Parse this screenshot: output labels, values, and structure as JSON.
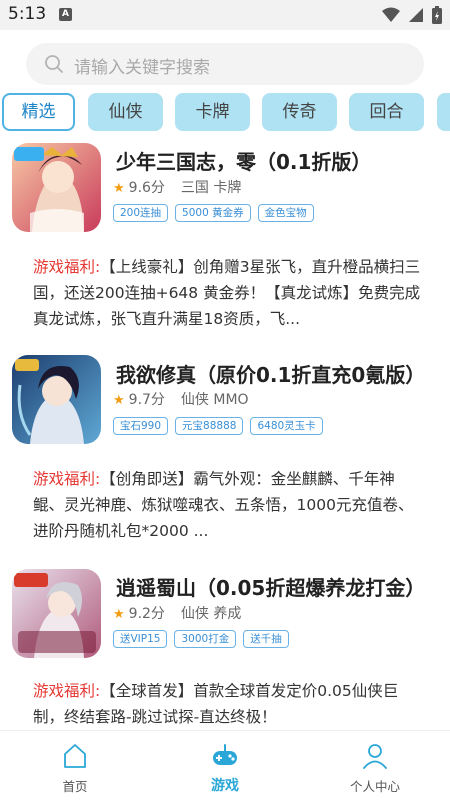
{
  "status": {
    "time": "5:13",
    "notif_letter": "A"
  },
  "search": {
    "placeholder": "请输入关键字搜索"
  },
  "tabs": [
    {
      "label": "精选",
      "active": true
    },
    {
      "label": "仙侠",
      "active": false
    },
    {
      "label": "卡牌",
      "active": false
    },
    {
      "label": "传奇",
      "active": false
    },
    {
      "label": "回合",
      "active": false
    }
  ],
  "games": [
    {
      "title": "少年三国志，零（0.1折版）",
      "rating": "9.6分",
      "tags": "三国 卡牌",
      "chips": [
        "200连抽",
        "5000 黄金券",
        "金色宝物"
      ],
      "benefit_label": "游戏福利:",
      "benefit_text": "【上线豪礼】创角赠3星张飞，直升橙品横扫三国，还送200连抽+648 黄金券！【真龙试炼】免费完成真龙试炼，张飞直升满星18资质，飞...",
      "cover_badge": "免费版"
    },
    {
      "title": "我欲修真（原价0.1折直充0氪版）",
      "rating": "9.7分",
      "tags": "仙侠 MMO",
      "chips": [
        "宝石990",
        "元宝88888",
        "6480灵玉卡"
      ],
      "benefit_label": "游戏福利:",
      "benefit_text": "【创角即送】霸气外观：金坐麒麟、千年神鲲、灵光神鹿、炼狱噬魂衣、五条悟，1000元充值卷、进阶丹随机礼包*2000 ...",
      "cover_badge": "1折"
    },
    {
      "title": "逍遥蜀山（0.05折超爆养龙打金）",
      "rating": "9.2分",
      "tags": "仙侠 养成",
      "chips": [
        "送VIP15",
        "3000打金",
        "送千抽"
      ],
      "benefit_label": "游戏福利:",
      "benefit_text": "【全球首发】首款全球首发定价0.05仙侠巨制，终结套路-跳过试探-直达终极！",
      "cover_badge": "0.05折",
      "cover_text": "福利仙侠"
    }
  ],
  "nav": [
    {
      "label": "首页",
      "active": false
    },
    {
      "label": "游戏",
      "active": true
    },
    {
      "label": "个人中心",
      "active": false
    }
  ],
  "colors": {
    "accent": "#2aa7d6",
    "tab_bg": "#afe2f3",
    "benefit_label": "#e53935",
    "star": "#f39c12"
  }
}
